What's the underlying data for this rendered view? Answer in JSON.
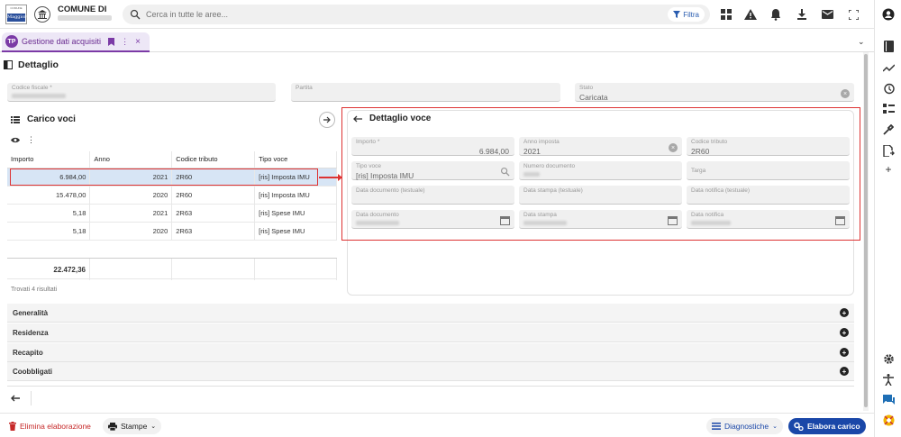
{
  "header": {
    "logo_top_text": "COMUNE",
    "logo_text": "Maggiore",
    "org_title": "COMUNE DI",
    "search_placeholder": "Cerca in tutte le aree...",
    "filter_label": "Filtra"
  },
  "tab": {
    "label": "Gestione dati acquisiti",
    "logo": "TP"
  },
  "page": {
    "title": "Dettaglio"
  },
  "top_fields": {
    "codice_fiscale": {
      "label": "Codice fiscale *",
      "value": ""
    },
    "partita": {
      "label": "Partita",
      "value": ""
    },
    "stato": {
      "label": "Stato",
      "value": "Caricata"
    }
  },
  "carico_voci": {
    "title": "Carico voci",
    "columns": [
      "Importo",
      "Anno",
      "Codice tributo",
      "Tipo voce"
    ],
    "rows": [
      {
        "importo": "6.984,00",
        "anno": "2021",
        "codice": "2R60",
        "tipo": "[ris] Imposta IMU"
      },
      {
        "importo": "15.478,00",
        "anno": "2020",
        "codice": "2R60",
        "tipo": "[ris] Imposta IMU"
      },
      {
        "importo": "5,18",
        "anno": "2021",
        "codice": "2R63",
        "tipo": "[ris] Spese IMU"
      },
      {
        "importo": "5,18",
        "anno": "2020",
        "codice": "2R63",
        "tipo": "[ris] Spese IMU"
      }
    ],
    "total": "22.472,36",
    "found_text": "Trovati 4 risultati"
  },
  "dettaglio_voce": {
    "title": "Dettaglio voce",
    "importo": {
      "label": "Importo *",
      "value": "6.984,00"
    },
    "anno_imposta": {
      "label": "Anno imposta",
      "value": "2021"
    },
    "codice_tributo": {
      "label": "Codice tributo",
      "value": "2R60"
    },
    "tipo_voce": {
      "label": "Tipo voce",
      "value": "[ris] Imposta IMU"
    },
    "numero_documento": {
      "label": "Numero documento",
      "value": ""
    },
    "targa": {
      "label": "Targa",
      "value": ""
    },
    "data_documento_testuale": {
      "label": "Data documento (testuale)",
      "value": ""
    },
    "data_stampa_testuale": {
      "label": "Data stampa (testuale)",
      "value": ""
    },
    "data_notifica_testuale": {
      "label": "Data notifica (testuale)",
      "value": ""
    },
    "data_documento": {
      "label": "Data documento",
      "value": ""
    },
    "data_stampa": {
      "label": "Data stampa",
      "value": ""
    },
    "data_notifica": {
      "label": "Data notifica",
      "value": ""
    }
  },
  "accordions": [
    "Generalità",
    "Residenza",
    "Recapito",
    "Coobbligati"
  ],
  "bottom": {
    "delete_label": "Elimina elaborazione",
    "print_label": "Stampe",
    "diag_label": "Diagnostiche",
    "process_label": "Elabora carico"
  },
  "colors": {
    "accent": "#1a47a8",
    "tab_purple": "#7b3aa6",
    "highlight_red": "#d33333",
    "selected_row": "#d7e5f5"
  }
}
